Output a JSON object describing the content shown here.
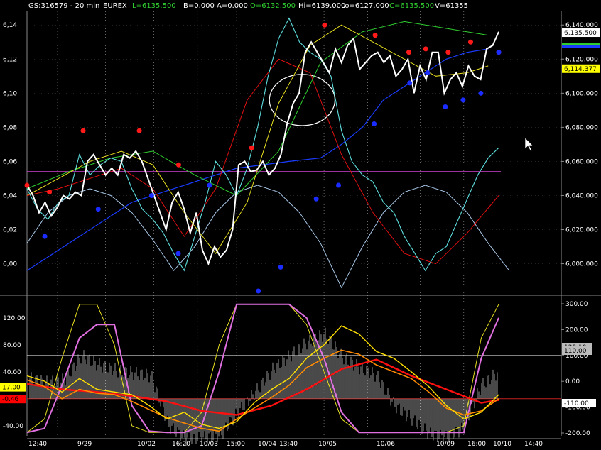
{
  "header": {
    "symbol": "GS:316579 - 20 min",
    "exchange": "EUREX",
    "last": "L=6135.500",
    "bid": "B=0.000",
    "ask": "A=0.000",
    "open": "O=6132.500",
    "high": "Hi=6139.000",
    "low": "Lo=6127.000",
    "close": "C=6135.500",
    "volume": "V=61355"
  },
  "colors": {
    "background": "#000000",
    "price": "#ffffff",
    "secondary": "#5fe0e0",
    "red_line": "#e01010",
    "green_line": "#30d030",
    "yellow_line": "#e8e020",
    "blue_line": "#1a3cff",
    "arc_line": "#a8c8e8",
    "magenta": "#d040d0",
    "dot_red": "#ff1a1a",
    "dot_blue": "#1a2cff",
    "histogram": "#b8b8b8",
    "osc_yellow": "#ffe000",
    "osc_orange": "#ff8a00",
    "osc_red": "#ff1010",
    "osc_pink": "#e070e0",
    "grid": "#888888"
  },
  "chart_data": [
    {
      "type": "line",
      "panel": "price",
      "y_ticks_left": [
        "6,14",
        "6,12",
        "6,10",
        "6,08",
        "6,06",
        "6,04",
        "6,02",
        "6,00"
      ],
      "y_ticks_right": [
        "6,140.000",
        "6,120.000",
        "6,100.000",
        "6,080.000",
        "6,060.000",
        "6,040.000",
        "6,020.000",
        "6,000.000"
      ],
      "ylim": [
        5984,
        6148
      ],
      "price_labels": [
        {
          "text": "6,135.500",
          "value": 6135.5,
          "bg": "#ffffff",
          "fg": "#000000"
        },
        {
          "text": "6,114.377",
          "value": 6114.377,
          "bg": "#ffff00",
          "fg": "#000000"
        }
      ],
      "horizontal_line": 6054,
      "ellipse_annotation": {
        "x_center": 63,
        "y_center": 6096,
        "x_radius": 7.5,
        "y_radius": 15
      },
      "series": [
        {
          "key": "price",
          "x": [
            0,
            1,
            2,
            3,
            4,
            5,
            6,
            7,
            8,
            9,
            10,
            11,
            12,
            13,
            14,
            15,
            16,
            17,
            18,
            19,
            20,
            21,
            22,
            23,
            24,
            25,
            26,
            27,
            28,
            29,
            30,
            31,
            32,
            33,
            34,
            35,
            36,
            37,
            38,
            39,
            40,
            41,
            42,
            43,
            44,
            45,
            46,
            47,
            48,
            49,
            50,
            51,
            52,
            53,
            54,
            55,
            56,
            57,
            58,
            59,
            60,
            61,
            62,
            63,
            64,
            65,
            66,
            67,
            68,
            69,
            70,
            71,
            72,
            73,
            74,
            75,
            76,
            77,
            78
          ],
          "values": [
            6046,
            6040,
            6030,
            6036,
            6028,
            6033,
            6040,
            6038,
            6042,
            6040,
            6060,
            6064,
            6058,
            6052,
            6056,
            6052,
            6064,
            6062,
            6066,
            6060,
            6050,
            6040,
            6030,
            6020,
            6036,
            6042,
            6032,
            6018,
            6030,
            6008,
            6000,
            6010,
            6004,
            6008,
            6020,
            6058,
            6060,
            6054,
            6055,
            6060,
            6052,
            6056,
            6064,
            6082,
            6094,
            6100,
            6124,
            6130,
            6124,
            6118,
            6112,
            6126,
            6118,
            6128,
            6132,
            6114,
            6118,
            6122,
            6124,
            6118,
            6122,
            6110,
            6114,
            6120,
            6100,
            6116,
            6108,
            6124,
            6124,
            6100,
            6108,
            6112,
            6104,
            6116,
            6110,
            6108,
            6126,
            6128,
            6136
          ]
        },
        {
          "key": "secondary",
          "x": [
            0,
            2,
            4,
            6,
            8,
            10,
            12,
            14,
            16,
            18,
            20,
            22,
            24,
            26,
            28,
            30,
            32,
            34,
            36,
            38,
            40,
            42,
            44,
            46,
            48,
            50,
            52,
            54,
            56,
            58,
            60,
            62,
            64,
            66,
            68,
            70,
            72,
            74,
            76,
            78,
            80,
            82,
            84,
            86,
            88,
            90
          ],
          "values": [
            6044,
            6032,
            6026,
            6036,
            6040,
            6064,
            6052,
            6058,
            6062,
            6060,
            6044,
            6032,
            6026,
            6018,
            6006,
            5996,
            6016,
            6036,
            6060,
            6052,
            6040,
            6056,
            6080,
            6110,
            6132,
            6144,
            6130,
            6124,
            6120,
            6110,
            6078,
            6060,
            6052,
            6048,
            6036,
            6030,
            6016,
            6006,
            5996,
            6006,
            6010,
            6024,
            6038,
            6052,
            6062,
            6068
          ]
        },
        {
          "key": "red_line",
          "x": [
            0,
            6,
            12,
            18,
            24,
            30,
            36,
            42,
            48,
            54,
            60,
            66,
            72,
            78,
            84,
            90
          ],
          "values": [
            6040,
            6044,
            6050,
            6056,
            6044,
            6016,
            6044,
            6096,
            6120,
            6112,
            6064,
            6030,
            6006,
            6000,
            6018,
            6040
          ]
        },
        {
          "key": "green_line",
          "x": [
            0,
            8,
            16,
            24,
            32,
            40,
            48,
            56,
            64,
            72,
            80,
            88
          ],
          "values": [
            6044,
            6054,
            6062,
            6066,
            6052,
            6040,
            6066,
            6118,
            6136,
            6142,
            6138,
            6134
          ]
        },
        {
          "key": "yellow_line",
          "x": [
            0,
            6,
            12,
            18,
            24,
            30,
            36,
            42,
            48,
            54,
            60,
            66,
            72,
            78,
            84,
            88
          ],
          "values": [
            6040,
            6050,
            6060,
            6066,
            6058,
            6030,
            6006,
            6036,
            6094,
            6128,
            6140,
            6130,
            6120,
            6110,
            6112,
            6116
          ]
        },
        {
          "key": "blue_line",
          "x": [
            0,
            10,
            20,
            30,
            40,
            50,
            56,
            60,
            64,
            68,
            72,
            76,
            80,
            84,
            88
          ],
          "values": [
            5996,
            6016,
            6036,
            6046,
            6056,
            6060,
            6062,
            6070,
            6080,
            6096,
            6104,
            6112,
            6120,
            6124,
            6126
          ]
        },
        {
          "key": "arc_line",
          "x": [
            0,
            4,
            8,
            12,
            16,
            20,
            24,
            28,
            32,
            36,
            40,
            44,
            48,
            52,
            56,
            60,
            64,
            68,
            72,
            76,
            80,
            84,
            88,
            92
          ],
          "values": [
            6012,
            6030,
            6040,
            6044,
            6040,
            6030,
            6014,
            5996,
            6010,
            6030,
            6042,
            6046,
            6042,
            6030,
            6012,
            5986,
            6010,
            6030,
            6042,
            6046,
            6042,
            6030,
            6012,
            5996
          ]
        }
      ],
      "dots_red": [
        [
          0,
          6046
        ],
        [
          4,
          6042
        ],
        [
          10,
          6078
        ],
        [
          20,
          6078
        ],
        [
          27,
          6058
        ],
        [
          40,
          6068
        ],
        [
          53,
          6140
        ],
        [
          62,
          6134
        ],
        [
          68,
          6124
        ],
        [
          71,
          6126
        ],
        [
          75,
          6124
        ],
        [
          79,
          6130
        ],
        [
          84,
          6124
        ]
      ],
      "dots_blue": [
        [
          4,
          6016
        ],
        [
          16,
          6032
        ],
        [
          28,
          6040
        ],
        [
          34,
          6006
        ],
        [
          41,
          6046
        ],
        [
          52,
          5984
        ],
        [
          57,
          5998
        ],
        [
          65,
          6038
        ],
        [
          70,
          6046
        ],
        [
          78,
          6082
        ],
        [
          86,
          6106
        ],
        [
          90,
          6112
        ],
        [
          94,
          6092
        ],
        [
          98,
          6096
        ],
        [
          102,
          6100
        ],
        [
          106,
          6124
        ]
      ]
    },
    {
      "type": "line",
      "panel": "oscillator",
      "y_ticks_left": [
        "120.00",
        "80.00",
        "40.00",
        "0.00",
        "-40.00"
      ],
      "y_ticks_right": [
        "300.00",
        "200.00",
        "100.00",
        "0.00",
        "-100.00",
        "-200.00"
      ],
      "ylim_left": [
        -55,
        145
      ],
      "value_labels": [
        {
          "text": "17.00",
          "value": 17,
          "bg": "#ffff00",
          "fg": "#000000"
        },
        {
          "text": "-0.46",
          "value": -0.46,
          "bg": "#ff0000",
          "fg": "#000000"
        },
        {
          "text": "129.10",
          "value": 129.1,
          "bg": "#bbbbbb",
          "fg": "#000000"
        },
        {
          "text": "-110.00",
          "value": -110,
          "bg": "#ffffff",
          "fg": "#000000"
        },
        {
          "text": "110.00",
          "value": 110,
          "bg": "#bbbbbb",
          "fg": "#000000"
        }
      ],
      "hlines_left": [
        64,
        0,
        -24
      ],
      "series": [
        {
          "key": "osc_yellow",
          "x": [
            0,
            4,
            8,
            12,
            16,
            20,
            24,
            28,
            32,
            36,
            40,
            44,
            48,
            52,
            56,
            60,
            64,
            68,
            72,
            76,
            80,
            84,
            88,
            92,
            96,
            100,
            104,
            108
          ],
          "values": [
            34,
            26,
            10,
            30,
            14,
            10,
            6,
            -10,
            -30,
            -20,
            -38,
            -44,
            -34,
            -6,
            14,
            30,
            60,
            80,
            108,
            96,
            70,
            60,
            40,
            18,
            -10,
            -30,
            -20,
            6
          ]
        },
        {
          "key": "osc_orange",
          "x": [
            0,
            4,
            8,
            12,
            16,
            20,
            24,
            28,
            32,
            36,
            40,
            44,
            48,
            52,
            56,
            60,
            64,
            68,
            72,
            76,
            80,
            84,
            88,
            92,
            96,
            100,
            104,
            108
          ],
          "values": [
            28,
            18,
            0,
            14,
            8,
            6,
            -4,
            -16,
            -28,
            -36,
            -44,
            -48,
            -30,
            -14,
            2,
            20,
            46,
            60,
            72,
            66,
            50,
            40,
            30,
            10,
            -14,
            -24,
            -18,
            0
          ]
        },
        {
          "key": "osc_red",
          "x": [
            0,
            8,
            16,
            24,
            32,
            40,
            48,
            56,
            64,
            72,
            80,
            88,
            96,
            104,
            108
          ],
          "values": [
            22,
            14,
            10,
            4,
            -4,
            -18,
            -24,
            -10,
            14,
            44,
            58,
            34,
            14,
            -6,
            -2
          ]
        },
        {
          "key": "osc_pink",
          "x": [
            0,
            4,
            8,
            12,
            16,
            20,
            24,
            28,
            32,
            36,
            40,
            44,
            48,
            52,
            56,
            60,
            64,
            68,
            72,
            76,
            80,
            84,
            88,
            92,
            96,
            100,
            104,
            108
          ],
          "values": [
            -50,
            -44,
            20,
            90,
            110,
            110,
            -10,
            -48,
            -50,
            -50,
            -40,
            40,
            140,
            140,
            140,
            140,
            120,
            60,
            -20,
            -50,
            -50,
            -50,
            -50,
            -50,
            -50,
            -50,
            60,
            120
          ]
        },
        {
          "key": "osc_thin_yellow",
          "x": [
            0,
            4,
            8,
            12,
            16,
            20,
            24,
            28,
            32,
            36,
            40,
            44,
            48,
            52,
            56,
            60,
            64,
            68,
            72,
            76,
            80,
            84,
            88,
            92,
            96,
            100,
            104,
            108
          ],
          "values": [
            -50,
            -30,
            60,
            140,
            140,
            80,
            -40,
            -50,
            -50,
            -50,
            -20,
            80,
            140,
            140,
            140,
            140,
            110,
            40,
            -30,
            -50,
            -50,
            -50,
            -50,
            -50,
            -50,
            -40,
            90,
            140
          ]
        }
      ],
      "histogram": {
        "x_step": 0.5,
        "seed_amplitude": [
          30,
          24,
          28,
          64,
          50,
          42,
          38,
          34,
          -40,
          -60,
          -58,
          -54,
          -20,
          10,
          44,
          64,
          84,
          96,
          62,
          46,
          34,
          -10,
          -30,
          -52,
          -58,
          -44,
          20,
          40
        ]
      }
    }
  ],
  "time_axis": {
    "labels": [
      "12:40",
      "9/29",
      "10/02",
      "16:20",
      "10/03",
      "15:00",
      "10/04",
      "13:40",
      "10/05",
      "10/06",
      "10/09",
      "16:00",
      "10/10",
      "14:40"
    ]
  }
}
